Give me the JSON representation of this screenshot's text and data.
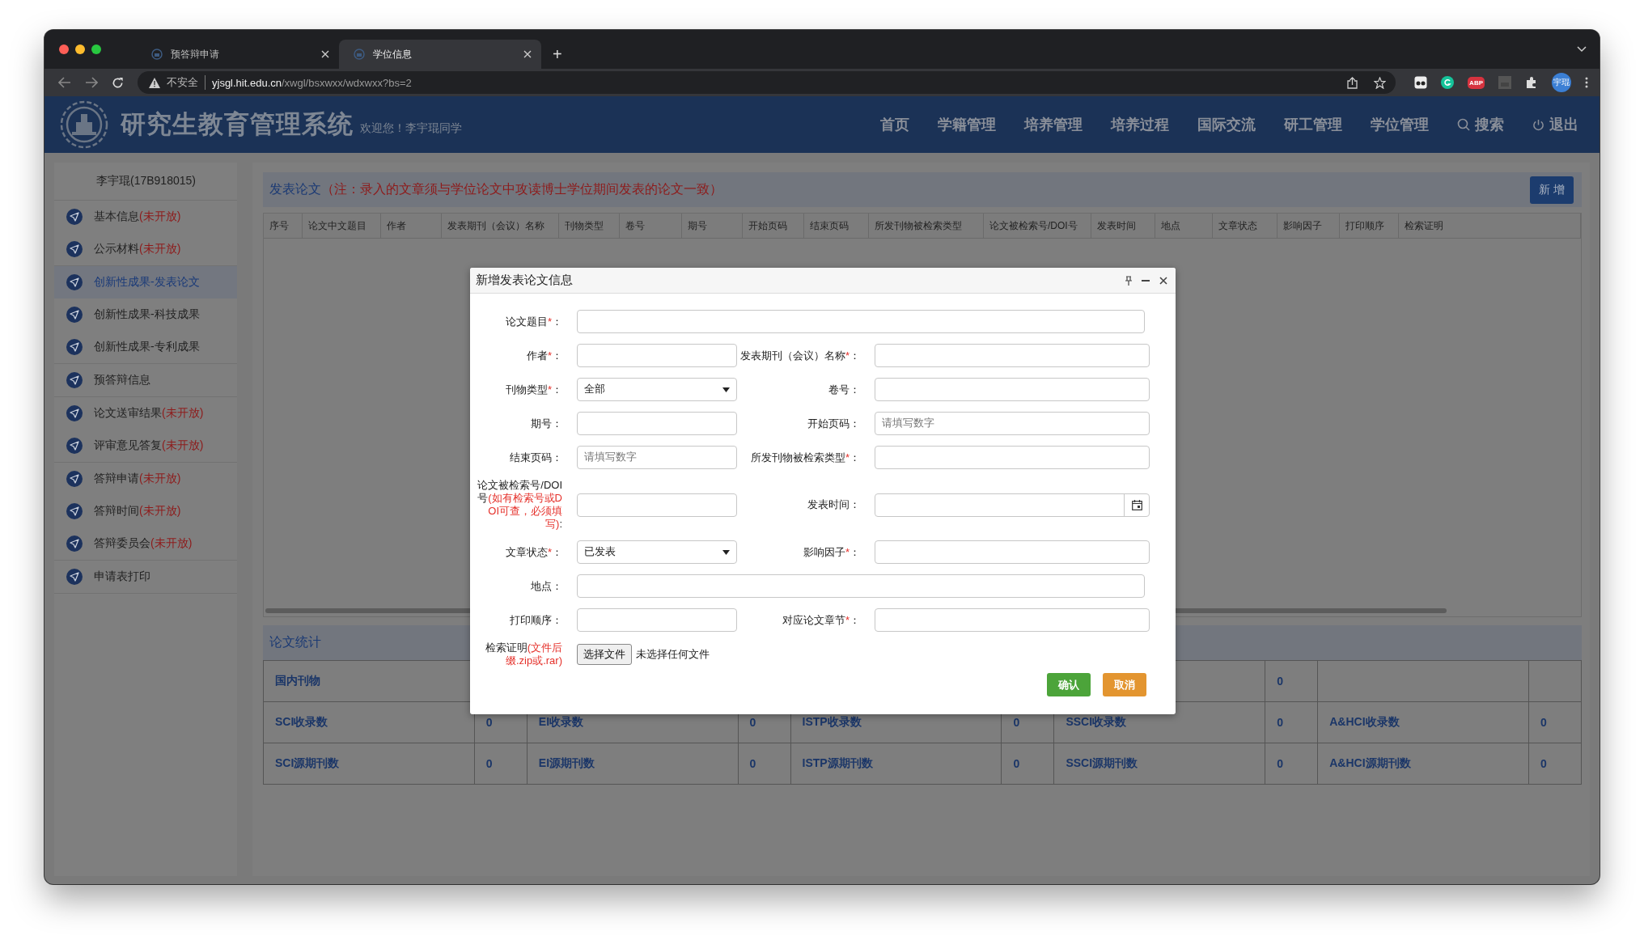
{
  "browser": {
    "tabs": [
      {
        "title": "预答辩申请",
        "selected": false
      },
      {
        "title": "学位信息",
        "selected": true
      }
    ],
    "new_tab": "+",
    "address": {
      "security": "不安全",
      "host": "yjsgl.hit.edu.cn",
      "path": "/xwgl/bsxwxx/wdxwxx?bs=2"
    },
    "extension_badge": "ABP",
    "profile": "宇琨"
  },
  "header": {
    "title": "研究生教育管理系统",
    "welcome": "欢迎您！李宇琨同学",
    "nav": [
      "首页",
      "学籍管理",
      "培养管理",
      "培养过程",
      "国际交流",
      "研工管理",
      "学位管理"
    ],
    "search": "搜索",
    "logout": "退出"
  },
  "sidebar": {
    "user": "李宇琨(17B918015)",
    "groups": [
      [
        {
          "label": "基本信息",
          "note": "(未开放)",
          "selected": false
        },
        {
          "label": "公示材料",
          "note": "(未开放)",
          "selected": false
        }
      ],
      [
        {
          "label": "创新性成果-发表论文",
          "selected": true
        },
        {
          "label": "创新性成果-科技成果",
          "selected": false
        },
        {
          "label": "创新性成果-专利成果",
          "selected": false
        }
      ],
      [
        {
          "label": "预答辩信息",
          "selected": false
        }
      ],
      [
        {
          "label": "论文送审结果",
          "note": "(未开放)",
          "selected": false
        },
        {
          "label": "评审意见答复",
          "note": "(未开放)",
          "selected": false
        }
      ],
      [
        {
          "label": "答辩申请",
          "note": "(未开放)",
          "selected": false
        },
        {
          "label": "答辩时间",
          "note": "(未开放)",
          "selected": false
        },
        {
          "label": "答辩委员会",
          "note": "(未开放)",
          "selected": false
        }
      ],
      [
        {
          "label": "申请表打印",
          "selected": false
        }
      ]
    ]
  },
  "papers": {
    "title": "发表论文",
    "note": "（注：录入的文章须与学位论文中攻读博士学位期间发表的论文一致）",
    "add_button": "新 增",
    "columns": [
      "序号",
      "论文中文题目",
      "作者",
      "发表期刊（会议）名称",
      "刊物类型",
      "卷号",
      "期号",
      "开始页码",
      "结束页码",
      "所发刊物被检索类型",
      "论文被检索号/DOI号",
      "发表时间",
      "地点",
      "文章状态",
      "影响因子",
      "打印顺序",
      "检索证明"
    ]
  },
  "stats": {
    "title": "论文统计",
    "rows": [
      [
        "国内刊物",
        null,
        null,
        null,
        null,
        null,
        null,
        "0",
        null,
        null
      ],
      [
        "SCI收录数",
        "0",
        "EI收录数",
        "0",
        "ISTP收录数",
        "0",
        "SSCI收录数",
        "0",
        "A&HCI收录数",
        "0"
      ],
      [
        "SCI源期刊数",
        "0",
        "EI源期刊数",
        "0",
        "ISTP源期刊数",
        "0",
        "SSCI源期刊数",
        "0",
        "A&HCI源期刊数",
        "0"
      ]
    ]
  },
  "dialog": {
    "title": "新增发表论文信息",
    "rows": [
      [
        {
          "kind": "text",
          "wide": true,
          "label": "论文题目",
          "required_mark": "*",
          "colon": "："
        }
      ],
      [
        {
          "kind": "text",
          "label": "作者",
          "required_mark": "*",
          "colon": "："
        },
        {
          "kind": "text",
          "label": "发表期刊（会议）名称",
          "required_mark": "*",
          "colon": "："
        }
      ],
      [
        {
          "kind": "select",
          "label": "刊物类型",
          "required_mark": "*",
          "colon": "：",
          "value": "全部"
        },
        {
          "kind": "text",
          "label": "卷号",
          "colon": "："
        }
      ],
      [
        {
          "kind": "text",
          "label": "期号",
          "colon": "："
        },
        {
          "kind": "text",
          "label": "开始页码",
          "colon": "：",
          "placeholder": "请填写数字"
        }
      ],
      [
        {
          "kind": "text",
          "label": "结束页码",
          "colon": "：",
          "placeholder": "请填写数字"
        },
        {
          "kind": "text",
          "label": "所发刊物被检索类型",
          "required_mark": "*",
          "colon": "："
        }
      ],
      [
        {
          "kind": "text",
          "label": "论文被检索号/DOI号",
          "note": "(如有检索号或DOI可查，必须填写)",
          "colon": ":"
        },
        {
          "kind": "date",
          "label": "发表时间",
          "colon": "："
        }
      ],
      [
        {
          "kind": "select",
          "label": "文章状态",
          "required_mark": "*",
          "colon": "：",
          "value": "已发表"
        },
        {
          "kind": "text",
          "label": "影响因子",
          "required_mark": "*",
          "colon": "："
        }
      ],
      [
        {
          "kind": "text",
          "wide": true,
          "label": "地点",
          "colon": "："
        }
      ],
      [
        {
          "kind": "text",
          "label": "打印顺序",
          "colon": "："
        },
        {
          "kind": "text",
          "label": "对应论文章节",
          "required_mark": "*",
          "colon": "："
        }
      ],
      [
        {
          "kind": "file",
          "label": "检索证明",
          "note": "(文件后缀.zip或.rar)",
          "button": "选择文件",
          "status": "未选择任何文件"
        }
      ]
    ],
    "buttons": [
      {
        "kind": "confirm",
        "label": "确认"
      },
      {
        "kind": "cancel",
        "label": "取消"
      }
    ]
  }
}
